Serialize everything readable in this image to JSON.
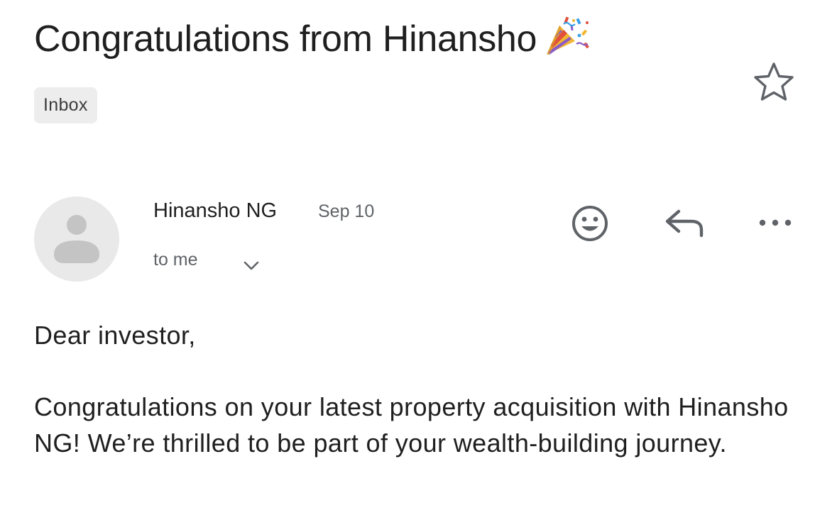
{
  "email": {
    "subject": "Congratulations from Hinansho",
    "subject_emoji": "party-popper-icon",
    "label": "Inbox",
    "starred": false
  },
  "sender": {
    "name": "Hinansho NG",
    "date": "Sep 10",
    "recipient_text": "to me"
  },
  "actions": [
    "emoji-reaction-icon",
    "reply-icon",
    "more-options-icon"
  ],
  "body": {
    "greeting": "Dear investor,",
    "paragraph": "Congratulations on your latest property acquisition with Hinansho NG! We’re thrilled to be part of your wealth-building journey."
  },
  "colors": {
    "text_primary": "#1f1f1f",
    "text_secondary": "#5f6368",
    "chip_bg": "#ededed",
    "avatar_bg": "#e9e9e9",
    "avatar_fg": "#c4c4c4",
    "icon": "#5f6368"
  }
}
